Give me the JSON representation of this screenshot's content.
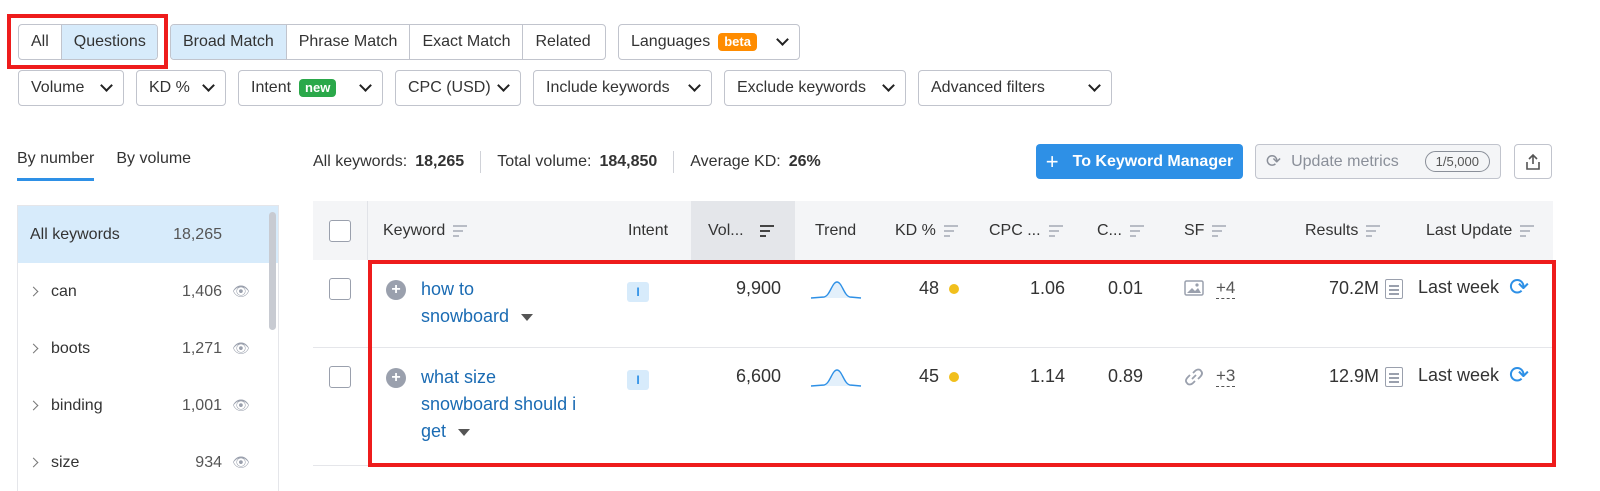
{
  "filters_row1": {
    "question_toggle": [
      "All",
      "Questions"
    ],
    "match_tabs": [
      "Broad Match",
      "Phrase Match",
      "Exact Match",
      "Related"
    ],
    "languages": {
      "label": "Languages",
      "badge": "beta"
    }
  },
  "filters_row2": {
    "volume": "Volume",
    "kd": "KD %",
    "intent": {
      "label": "Intent",
      "badge": "new"
    },
    "cpc": "CPC (USD)",
    "include": "Include keywords",
    "exclude": "Exclude keywords",
    "advanced": "Advanced filters"
  },
  "side_tabs": [
    "By number",
    "By volume"
  ],
  "side_groups": [
    {
      "label": "All keywords",
      "count": "18,265"
    },
    {
      "label": "can",
      "count": "1,406"
    },
    {
      "label": "boots",
      "count": "1,271"
    },
    {
      "label": "binding",
      "count": "1,001"
    },
    {
      "label": "size",
      "count": "934"
    }
  ],
  "stats": {
    "all_label": "All keywords:",
    "all_value": "18,265",
    "volume_label": "Total volume:",
    "volume_value": "184,850",
    "kd_label": "Average KD:",
    "kd_value": "26%"
  },
  "actions": {
    "keyword_manager": "To Keyword Manager",
    "update_metrics": "Update metrics",
    "update_quota": "1/5,000"
  },
  "table": {
    "headers": {
      "keyword": "Keyword",
      "intent": "Intent",
      "volume": "Vol...",
      "trend": "Trend",
      "kd": "KD %",
      "cpc": "CPC ...",
      "com": "C...",
      "sf": "SF",
      "results": "Results",
      "last_update": "Last Update"
    },
    "rows": [
      {
        "keyword_lines": [
          "how to",
          "snowboard"
        ],
        "intent": "I",
        "volume": "9,900",
        "kd": "48",
        "cpc": "1.06",
        "com": "0.01",
        "sf_more": "+4",
        "results": "70.2M",
        "last_update": "Last week"
      },
      {
        "keyword_lines": [
          "what size",
          "snowboard should i",
          "get"
        ],
        "intent": "I",
        "volume": "6,600",
        "kd": "45",
        "cpc": "1.14",
        "com": "0.89",
        "sf_more": "+3",
        "results": "12.9M",
        "last_update": "Last week"
      }
    ]
  },
  "colors": {
    "accent": "#2e90e6",
    "highlight_box": "#ee1c1c",
    "kd_dot": "#f1bf1c"
  }
}
